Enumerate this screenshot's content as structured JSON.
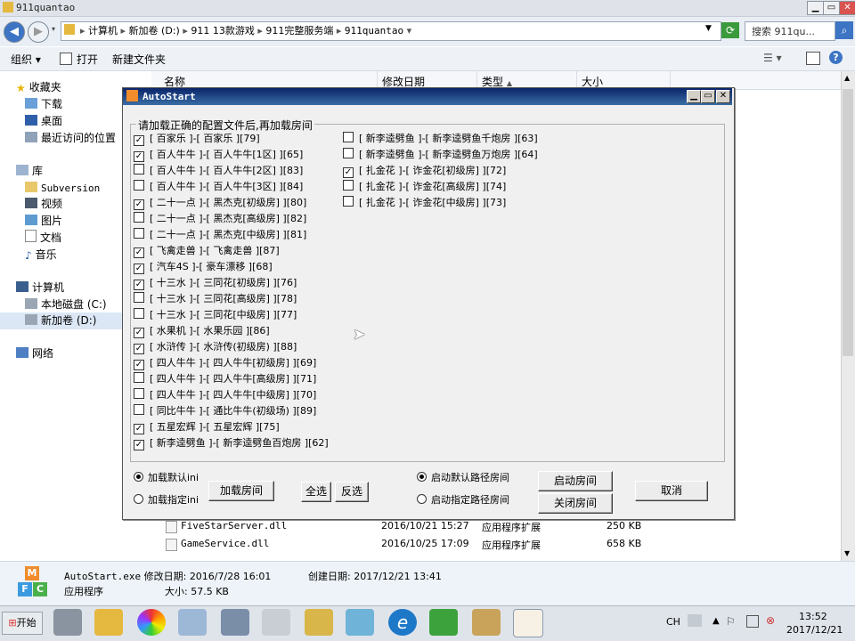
{
  "window": {
    "title": "911quantao",
    "min": "▁",
    "max": "▭",
    "close": "✕"
  },
  "address": {
    "path": [
      "计算机",
      "新加卷 (D:)",
      "911 13款游戏",
      "911完整服务端",
      "911quantao"
    ],
    "search_placeholder": "搜索 911qu..."
  },
  "toolbar": {
    "organize": "组织",
    "open": "打开",
    "new_folder": "新建文件夹"
  },
  "nav": {
    "favorites": "收藏夹",
    "downloads": "下载",
    "desktop": "桌面",
    "recent": "最近访问的位置",
    "libraries": "库",
    "subversion": "Subversion",
    "videos": "视频",
    "pictures": "图片",
    "documents": "文档",
    "music": "音乐",
    "computer": "计算机",
    "local_disk": "本地磁盘 (C:)",
    "new_volume": "新加卷 (D:)",
    "network": "网络"
  },
  "columns": {
    "name": "名称",
    "modified": "修改日期",
    "type": "类型",
    "size": "大小"
  },
  "files": [
    {
      "name": "FiveStarServer.dll",
      "modified": "2016/10/21 15:27",
      "type": "应用程序扩展",
      "size": "250 KB"
    },
    {
      "name": "GameService.dll",
      "modified": "2016/10/25 17:09",
      "type": "应用程序扩展",
      "size": "658 KB"
    }
  ],
  "details": {
    "name": "AutoStart.exe",
    "modified_label": "修改日期:",
    "modified": "2016/7/28 16:01",
    "created_label": "创建日期:",
    "created": "2017/12/21 13:41",
    "type": "应用程序",
    "size_label": "大小:",
    "size": "57.5 KB"
  },
  "dialog": {
    "title": "AutoStart",
    "group_label": "请加载正确的配置文件后,再加载房间",
    "checks_left": [
      {
        "label": "[ 百家乐 ]-[ 百家乐 ][79]",
        "checked": true
      },
      {
        "label": "[ 百人牛牛 ]-[ 百人牛牛[1区] ][65]",
        "checked": true
      },
      {
        "label": "[ 百人牛牛 ]-[ 百人牛牛[2区] ][83]",
        "checked": false
      },
      {
        "label": "[ 百人牛牛 ]-[ 百人牛牛[3区] ][84]",
        "checked": false
      },
      {
        "label": "[ 二十一点 ]-[ 黑杰克[初级房] ][80]",
        "checked": true
      },
      {
        "label": "[ 二十一点 ]-[ 黑杰克[高级房] ][82]",
        "checked": false
      },
      {
        "label": "[ 二十一点 ]-[ 黑杰克[中级房] ][81]",
        "checked": false
      },
      {
        "label": "[ 飞禽走兽 ]-[ 飞禽走兽 ][87]",
        "checked": true
      },
      {
        "label": "[ 汽车4S ]-[ 豪车漂移 ][68]",
        "checked": true
      },
      {
        "label": "[ 十三水 ]-[ 三同花[初级房] ][76]",
        "checked": true
      },
      {
        "label": "[ 十三水 ]-[ 三同花[高级房] ][78]",
        "checked": false
      },
      {
        "label": "[ 十三水 ]-[ 三同花[中级房] ][77]",
        "checked": false
      },
      {
        "label": "[ 水果机 ]-[ 水果乐园 ][86]",
        "checked": true
      },
      {
        "label": "[ 水浒传 ]-[ 水浒传(初级房) ][88]",
        "checked": true
      },
      {
        "label": "[ 四人牛牛 ]-[ 四人牛牛[初级房] ][69]",
        "checked": true
      },
      {
        "label": "[ 四人牛牛 ]-[ 四人牛牛[高级房] ][71]",
        "checked": false
      },
      {
        "label": "[ 四人牛牛 ]-[ 四人牛牛[中级房] ][70]",
        "checked": false
      },
      {
        "label": "[ 同比牛牛 ]-[ 通比牛牛(初级场) ][89]",
        "checked": false
      },
      {
        "label": "[ 五星宏辉 ]-[ 五星宏辉 ][75]",
        "checked": true
      },
      {
        "label": "[ 新李逵劈鱼 ]-[ 新李逵劈鱼百炮房 ][62]",
        "checked": true
      }
    ],
    "checks_right": [
      {
        "label": "[ 新李逵劈鱼 ]-[ 新李逵劈鱼千炮房 ][63]",
        "checked": false
      },
      {
        "label": "[ 新李逵劈鱼 ]-[ 新李逵劈鱼万炮房 ][64]",
        "checked": false
      },
      {
        "label": "[ 扎金花 ]-[ 诈金花[初级房] ][72]",
        "checked": true
      },
      {
        "label": "[ 扎金花 ]-[ 诈金花[高级房] ][74]",
        "checked": false
      },
      {
        "label": "[ 扎金花 ]-[ 诈金花[中级房] ][73]",
        "checked": false
      }
    ],
    "radio_load_default": "加载默认ini",
    "radio_load_specified": "加载指定ini",
    "btn_load_room": "加载房间",
    "btn_select_all": "全选",
    "btn_invert": "反选",
    "radio_default_path": "启动默认路径房间",
    "radio_specified_path": "启动指定路径房间",
    "btn_start_room": "启动房间",
    "btn_close_room": "关闭房间",
    "btn_cancel": "取消"
  },
  "taskbar": {
    "start": "开始",
    "lang": "CH",
    "time": "13:52",
    "date": "2017/12/21"
  },
  "colors": {
    "dialog_title": "#0a246a",
    "dialog_bg": "#f0f0f0",
    "explorer_bg": "#e9eef5"
  }
}
